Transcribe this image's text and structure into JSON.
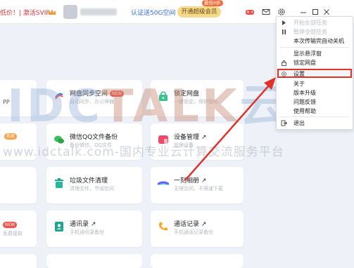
{
  "titlebar": {
    "promo_text": "低价！| 激活SVIP",
    "auth_link": "认证送50G空间",
    "upgrade_button": "开通超级会员",
    "upgrade_badge": "最低6折"
  },
  "cards": [
    {
      "title": "网盘同步空间",
      "tag": "NEW",
      "subtitle": "自动同步，办公神器"
    },
    {
      "title": "锁定网盘",
      "subtitle": "一键锁定，保护隐私"
    },
    {
      "title": "微信QQ文件备份",
      "subtitle": "备份微信、QQ文件"
    },
    {
      "title": "设备管理 ↗",
      "subtitle": "管理设备"
    },
    {
      "title": "垃圾文件清理",
      "subtitle": "清理文件，节省空间"
    },
    {
      "title": "一刻相册 ↗",
      "subtitle": "无限空间、不限速下载"
    },
    {
      "title": "通讯录 ↗",
      "subtitle": "手机通讯录备份"
    },
    {
      "title": "通话记录 ↗",
      "subtitle": "手机通话记录备份"
    }
  ],
  "left_fragments": {
    "pp": "PP",
    "hot": "热卖",
    "new": "NEW",
    "sub1": "免费提取"
  },
  "watermark": {
    "logo_pre": "IDC",
    "logo_mid": "TALK",
    "logo_post": "云说",
    "text": "www.idctalk.com-国内专业云计算交流服务平台"
  },
  "menu": {
    "items": [
      {
        "label": "开始全部任务",
        "disabled": true
      },
      {
        "label": "暂停全部任务",
        "disabled": true
      },
      {
        "label": "本次传输完自动关机"
      },
      {
        "label": "显示悬浮窗"
      },
      {
        "label": "锁定网盘"
      },
      {
        "label": "设置"
      },
      {
        "label": "关于"
      },
      {
        "label": "版本升级"
      },
      {
        "label": "问题反馈"
      },
      {
        "label": "使用帮助"
      },
      {
        "label": "退出"
      }
    ]
  },
  "colors": {
    "accent_blue": "#2f6fe0",
    "highlight_red": "#e0322a",
    "upgrade_gold": "#f7d98a",
    "new_tag_red": "#f0524b"
  }
}
